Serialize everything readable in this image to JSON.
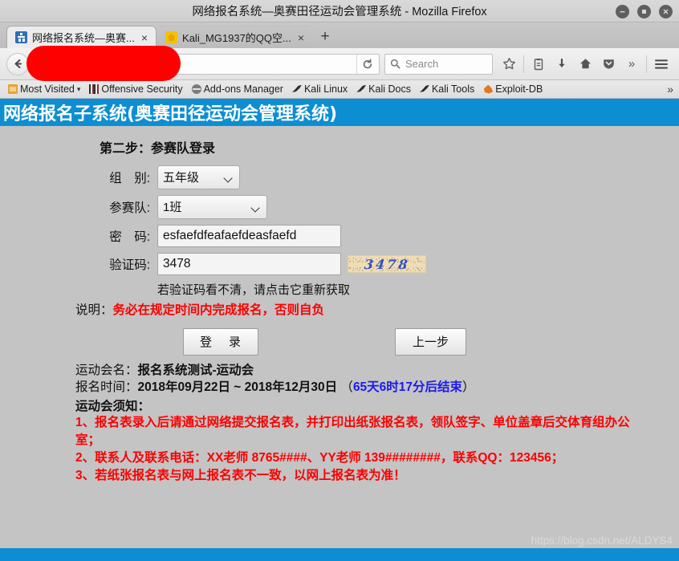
{
  "window": {
    "title": "网络报名系统—奥赛田径运动会管理系统 - Mozilla Firefox",
    "minimize_label": "minimize",
    "maximize_label": "maximize",
    "close_label": "close"
  },
  "tabs": [
    {
      "title": "网络报名系统—奥赛...",
      "favicon": "site-runner-icon",
      "close": "×",
      "active": true
    },
    {
      "title": "Kali_MG1937的QQ空...",
      "favicon": "qq-star-icon",
      "close": "×",
      "active": false
    }
  ],
  "newtab_label": "+",
  "toolbar": {
    "back_label": "back",
    "url_value": "",
    "url_placeholder": "",
    "reload_label": "reload",
    "search_placeholder": "Search",
    "overflow_label": "»",
    "menu_label": "menu",
    "icons": [
      "star-icon",
      "library-icon",
      "downloads-icon",
      "home-icon",
      "pocket-icon",
      "chevrons-icon",
      "hamburger-icon"
    ]
  },
  "bookmarks": {
    "items": [
      {
        "label": "Most Visited",
        "icon": "folder-icon",
        "caret": "▾"
      },
      {
        "label": "Offensive Security",
        "icon": "bars-icon",
        "caret": ""
      },
      {
        "label": "Add-ons Manager",
        "icon": "globe-icon",
        "caret": ""
      },
      {
        "label": "Kali Linux",
        "icon": "dragon-icon",
        "caret": ""
      },
      {
        "label": "Kali Docs",
        "icon": "dragon-icon",
        "caret": ""
      },
      {
        "label": "Kali Tools",
        "icon": "dragon-icon",
        "caret": ""
      },
      {
        "label": "Exploit-DB",
        "icon": "flame-icon",
        "caret": ""
      }
    ],
    "overflow": "»"
  },
  "page": {
    "header_title": "网络报名子系统(奥赛田径运动会管理系统)",
    "header_color": "#0d8ed2",
    "step_title": "第二步：参赛队登录",
    "form": {
      "grade": {
        "label": "组　别:",
        "value": "五年级",
        "options": [
          "五年级"
        ]
      },
      "team": {
        "label": "参赛队:",
        "value": "1班",
        "options": [
          "1班"
        ]
      },
      "password": {
        "label": "密　码:",
        "value": "esfaefdfeafaefdeasfaefd",
        "placeholder": ""
      },
      "captcha": {
        "label": "验证码:",
        "value": "3478",
        "placeholder": "",
        "image_code": "3478"
      }
    },
    "captcha_hint": "若验证码看不清，请点击它重新获取",
    "notice_prefix": "说明：",
    "notice_red": "务必在规定时间内完成报名，否则自负",
    "buttons": {
      "login": "登　录",
      "prev": "上一步"
    },
    "meet_name_label": "运动会名：",
    "meet_name_value": "报名系统测试-运动会",
    "signup_time_label": "报名时间：",
    "signup_time_value": "2018年09月22日 ~ 2018年12月30日",
    "countdown_open": "（",
    "countdown": "65天6时17分后结束",
    "countdown_close": "）",
    "notice_title": "运动会须知：",
    "notice_items": [
      "1、报名表录入后请通过网络提交报名表，并打印出纸张报名表，领队签字、单位盖章后交体育组办公室；",
      "2、联系人及联系电话：XX老师 8765####、YY老师 139########，联系QQ：123456；",
      "3、若纸张报名表与网上报名表不一致，以网上报名表为准！"
    ],
    "watermark": "https://blog.csdn.net/ALDYS4",
    "accent_red": "#fb0000",
    "accent_blue": "#1a1aee"
  }
}
